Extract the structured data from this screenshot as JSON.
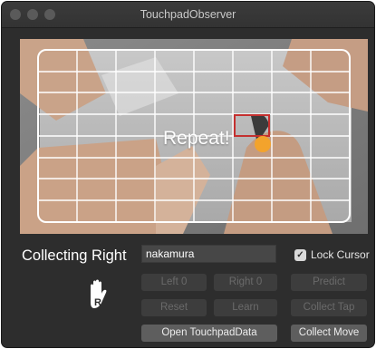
{
  "window": {
    "title": "TouchpadObserver"
  },
  "camera": {
    "overlay_text": "Repeat!"
  },
  "status": {
    "collecting_label": "Collecting Right",
    "hand_icon": "hand-right-icon"
  },
  "form": {
    "name_value": "nakamura",
    "lock_cursor_label": "Lock Cursor",
    "lock_cursor_checked": true
  },
  "buttons": {
    "left0": "Left 0",
    "right0": "Right 0",
    "predict": "Predict",
    "reset": "Reset",
    "learn": "Learn",
    "collect_tap": "Collect Tap",
    "open_data": "Open TouchpadData",
    "collect_move": "Collect Move"
  },
  "colors": {
    "window_bg": "#2d2d2d",
    "target_box": "#c4302f",
    "cursor_dot": "#f3a32c"
  }
}
